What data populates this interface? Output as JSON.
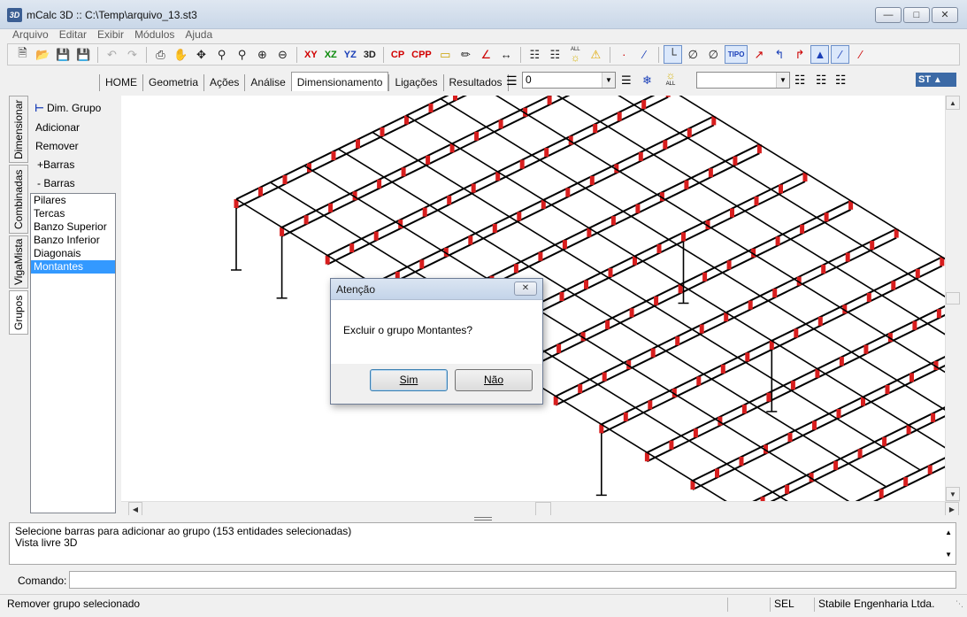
{
  "window": {
    "title": "mCalc 3D :: C:\\Temp\\arquivo_13.st3",
    "icon_text": "3D",
    "buttons": [
      "minimize",
      "maximize",
      "close"
    ]
  },
  "menu": [
    "Arquivo",
    "Editar",
    "Exibir",
    "Módulos",
    "Ajuda"
  ],
  "toolbar": {
    "view_buttons": [
      "XY",
      "XZ",
      "YZ",
      "3D"
    ],
    "load_buttons": [
      "CP",
      "CPP"
    ],
    "all_label": "ALL",
    "tipo_label": "TIPO"
  },
  "tabs": [
    "HOME",
    "Geometria",
    "Ações",
    "Análise",
    "Dimensionamento",
    "Ligações",
    "Resultados"
  ],
  "active_tab": "Dimensionamento",
  "layer_combo": {
    "value": "0"
  },
  "second_combo": {
    "value": ""
  },
  "logo": "ST",
  "vertical_tabs": [
    "Dimensionar",
    "Combinadas",
    "VigaMista",
    "Grupos"
  ],
  "left_panel": {
    "dim_grupo": "Dim. Grupo",
    "adicionar": "Adicionar",
    "remover": "Remover",
    "mais_barras": "+Barras",
    "menos_barras": "- Barras",
    "groups": [
      "Pilares",
      "Tercas",
      "Banzo Superior",
      "Banzo Inferior",
      "Diagonais",
      "Montantes"
    ],
    "selected_group": "Montantes"
  },
  "dialog": {
    "title": "Atenção",
    "message": "Excluir o grupo Montantes?",
    "yes": "Sim",
    "no": "Não"
  },
  "console": {
    "line1": "Selecione barras para adicionar ao grupo (153 entidades selecionadas)",
    "line2": "Vista livre 3D"
  },
  "command_label": "Comando:",
  "status": {
    "message": "Remover grupo selecionado",
    "mode": "SEL",
    "company": "Stabile Engenharia Ltda."
  },
  "colors": {
    "accent": "#3399ff",
    "member_red": "#d81e1e",
    "structure": "#000000"
  }
}
